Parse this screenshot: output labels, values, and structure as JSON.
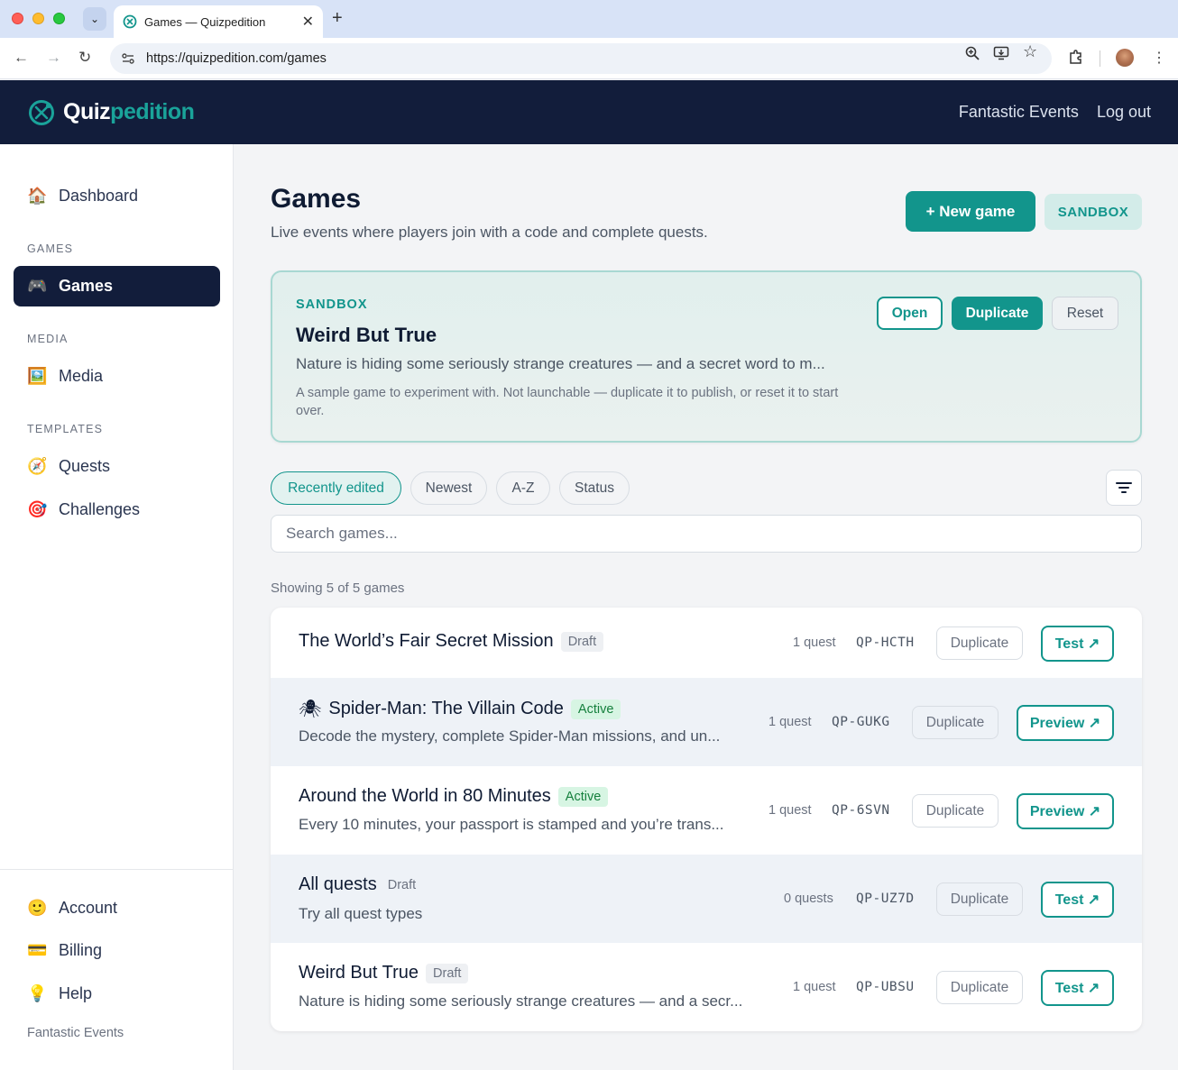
{
  "browser": {
    "tab_title": "Games — Quizpedition",
    "url": "https://quizpedition.com/games"
  },
  "header": {
    "logo_part1": "Quiz",
    "logo_part2": "pedition",
    "org_link": "Fantastic Events",
    "logout": "Log out"
  },
  "sidebar": {
    "dashboard": "Dashboard",
    "section_games": "GAMES",
    "games": "Games",
    "section_media": "MEDIA",
    "media": "Media",
    "section_templates": "TEMPLATES",
    "quests": "Quests",
    "challenges": "Challenges",
    "account": "Account",
    "billing": "Billing",
    "help": "Help",
    "footer_org": "Fantastic Events",
    "icons": {
      "dashboard": "🏠",
      "games": "🎮",
      "media": "🖼️",
      "quests": "🧭",
      "challenges": "🎯",
      "account": "🙂",
      "billing": "💳",
      "help": "💡"
    }
  },
  "page": {
    "title": "Games",
    "subtitle": "Live events where players join with a code and complete quests.",
    "new_game": "+ New game",
    "sandbox_btn": "SANDBOX"
  },
  "sandbox_card": {
    "label": "SANDBOX",
    "title": "Weird But True",
    "description": "Nature is hiding some seriously strange creatures — and a secret word to m...",
    "note": "A sample game to experiment with. Not launchable — duplicate it to publish, or reset it to start over.",
    "open": "Open",
    "duplicate": "Duplicate",
    "reset": "Reset"
  },
  "sort_chips": [
    "Recently edited",
    "Newest",
    "A-Z",
    "Status"
  ],
  "search": {
    "placeholder": "Search games..."
  },
  "showing": "Showing 5 of 5 games",
  "games": [
    {
      "emoji": "",
      "title": "The World’s Fair Secret Mission",
      "status": "Draft",
      "description": "",
      "quests": "1 quest",
      "code": "QP-HCTH",
      "duplicate": "Duplicate",
      "action": "Test ↗"
    },
    {
      "emoji": "🕷",
      "title": "Spider-Man: The Villain Code",
      "status": "Active",
      "description": "Decode the mystery, complete Spider-Man missions, and un...",
      "quests": "1 quest",
      "code": "QP-GUKG",
      "duplicate": "Duplicate",
      "action": "Preview ↗"
    },
    {
      "emoji": "",
      "title": "Around the World in 80 Minutes",
      "status": "Active",
      "description": "Every 10 minutes, your passport is stamped and you’re trans...",
      "quests": "1 quest",
      "code": "QP-6SVN",
      "duplicate": "Duplicate",
      "action": "Preview ↗"
    },
    {
      "emoji": "",
      "title": "All quests",
      "status": "Draft",
      "description": "Try all quest types",
      "quests": "0 quests",
      "code": "QP-UZ7D",
      "duplicate": "Duplicate",
      "action": "Test ↗"
    },
    {
      "emoji": "",
      "title": "Weird But True",
      "status": "Draft",
      "description": "Nature is hiding some seriously strange creatures — and a secr...",
      "quests": "1 quest",
      "code": "QP-UBSU",
      "duplicate": "Duplicate",
      "action": "Test ↗"
    }
  ],
  "colors": {
    "brand_navy": "#121d3b",
    "brand_teal": "#12958c",
    "active_badge": "#d7f5e3"
  }
}
